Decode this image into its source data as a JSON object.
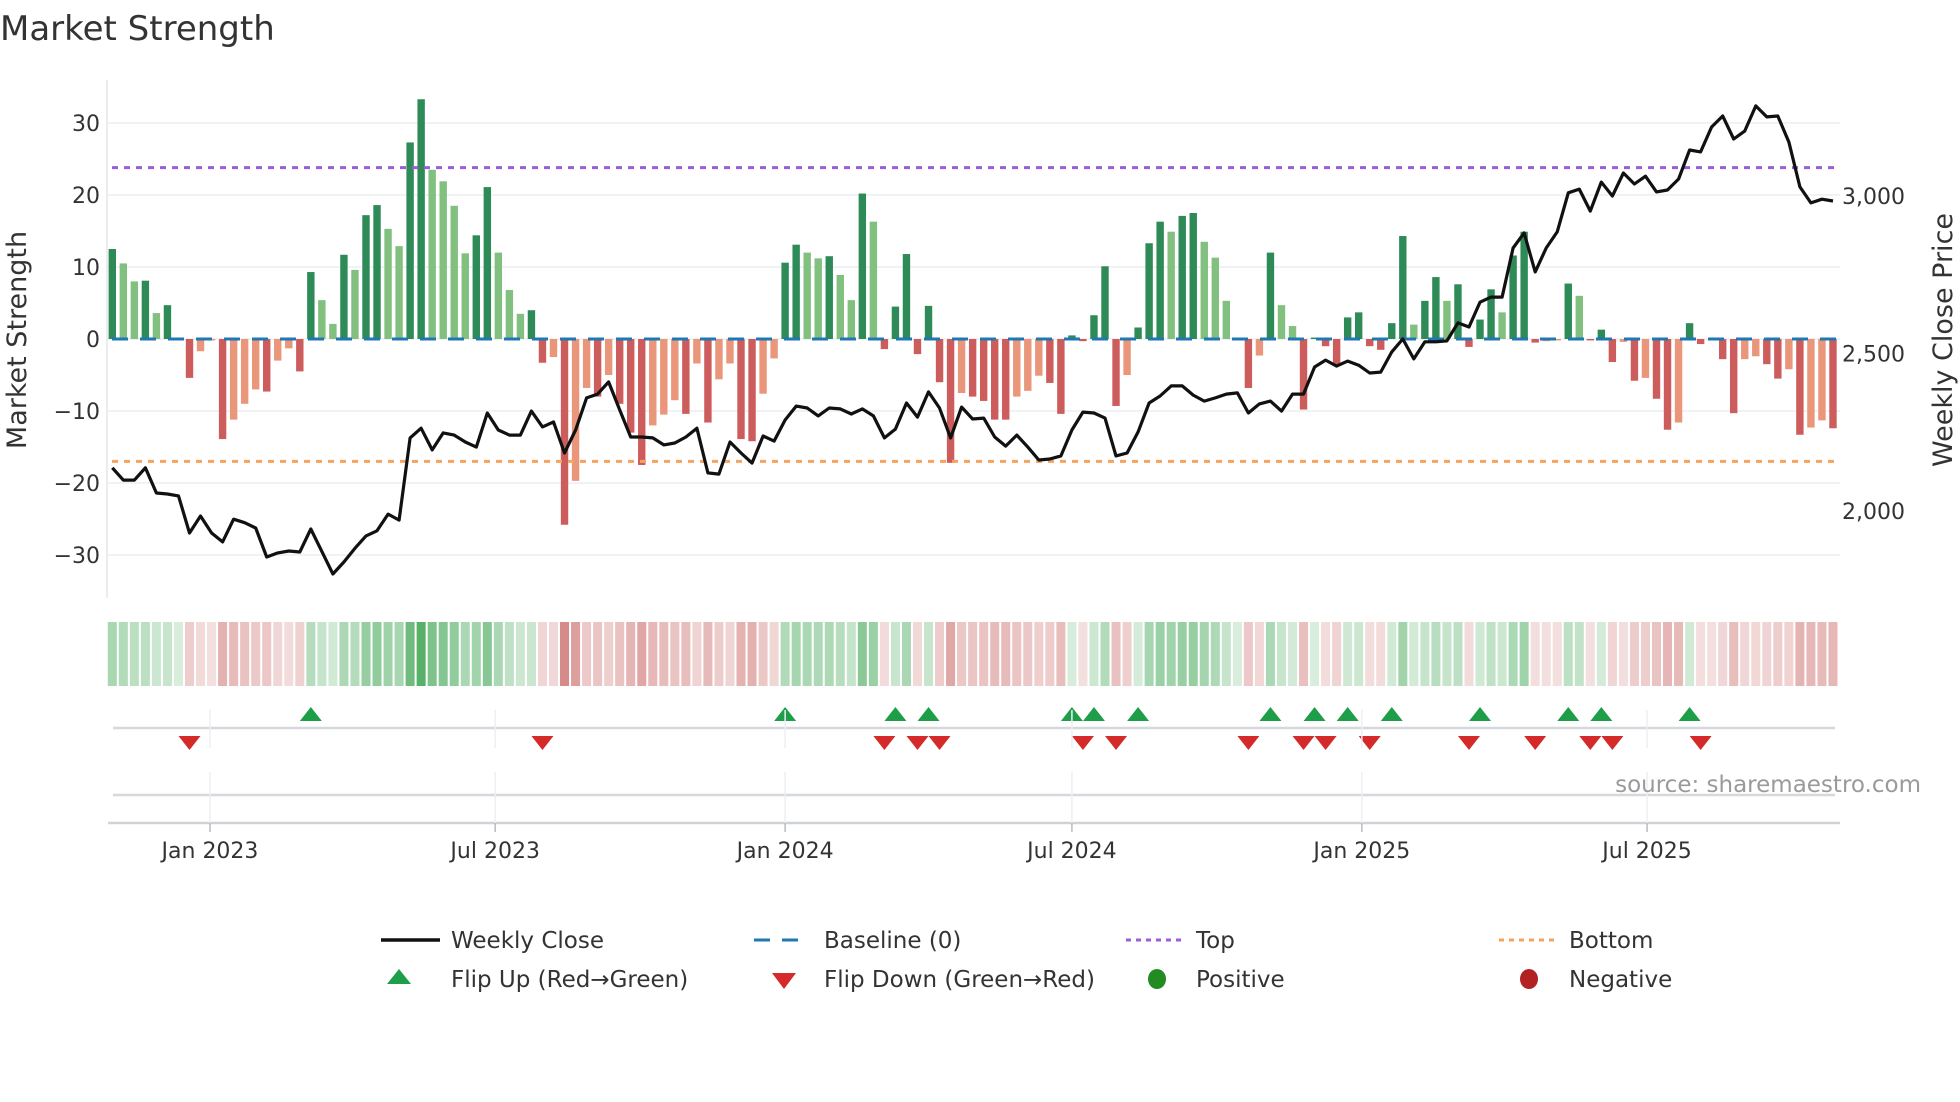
{
  "chart_data": {
    "type": "bar",
    "title": "Market Strength",
    "ylabel": "Market Strength",
    "y2label": "Weekly Close Price",
    "ylim": [
      -36,
      36
    ],
    "y2lim": [
      1700,
      3400
    ],
    "yticks": [
      30,
      20,
      10,
      0,
      -10,
      -20,
      -30
    ],
    "ytick_labels": [
      "30",
      "20",
      "10",
      "0",
      "−10",
      "−20",
      "−30"
    ],
    "y2ticks": [
      3000,
      2500,
      2000
    ],
    "y2tick_labels": [
      "3,000",
      "2,500",
      "2,000"
    ],
    "x_start": "2022-10-31",
    "x_step_days": 7,
    "xticks": [
      "2023-01-01",
      "2023-07-01",
      "2024-01-01",
      "2024-07-01",
      "2025-01-01",
      "2025-07-01"
    ],
    "xtick_labels": [
      "Jan 2023",
      "Jul 2023",
      "Jan 2024",
      "Jul 2024",
      "Jan 2025",
      "Jul 2025"
    ],
    "top_level": 23.8,
    "bottom_level": -17.0,
    "baseline": 0,
    "series": [
      {
        "name": "Market Strength",
        "type": "bar",
        "values": [
          12.5,
          10.5,
          8,
          8.1,
          3.6,
          4.7,
          0.2,
          -5.4,
          -1.7,
          -0.2,
          -13.9,
          -11.2,
          -9,
          -7,
          -7.3,
          -3,
          -1.3,
          -4.5,
          9.3,
          5.4,
          2.1,
          11.7,
          9.6,
          17.2,
          18.6,
          15.3,
          12.9,
          27.3,
          33.3,
          23.5,
          21.9,
          18.5,
          11.9,
          14.4,
          21.1,
          12,
          6.8,
          3.5,
          4,
          -3.3,
          -2.5,
          -25.8,
          -19.7,
          -6.8,
          -8,
          -5,
          -9,
          -13,
          -17.5,
          -12,
          -10.5,
          -8.5,
          -10.4,
          -3.4,
          -11.6,
          -5.6,
          -3.4,
          -13.9,
          -14.2,
          -7.6,
          -2.7,
          10.6,
          13.1,
          12,
          11.2,
          11.5,
          8.9,
          5.4,
          20.2,
          16.3,
          -1.4,
          4.5,
          11.8,
          -2.1,
          4.6,
          -6,
          -17.2,
          -7.5,
          -8,
          -8.6,
          -11.2,
          -11.2,
          -8,
          -7.2,
          -5.1,
          -6.1,
          -10.4,
          0.5,
          -0.3,
          3.3,
          10.1,
          -9.3,
          -5,
          1.6,
          13.3,
          16.3,
          14.9,
          17.1,
          17.5,
          13.5,
          11.3,
          5.3,
          0.2,
          -6.8,
          -2.3,
          12,
          4.7,
          1.8,
          -9.8,
          0.2,
          -1,
          -3.6,
          3,
          3.7,
          -1,
          -1.5,
          2.2,
          14.3,
          2,
          5.3,
          8.6,
          5.3,
          7.6,
          -1.1,
          2.7,
          6.9,
          3.7,
          11.6,
          14.9,
          -0.5,
          -0.3,
          -0.2,
          7.7,
          6,
          -0.2,
          1.3,
          -3.2,
          -0.4,
          -5.8,
          -5.4,
          -8.3,
          -12.6,
          -11.6,
          2.2,
          -0.7,
          -0.2,
          -2.8,
          -10.3,
          -2.8,
          -2.4,
          -3.5,
          -5.5,
          -4.2,
          -13.3,
          -12.3,
          -11.3,
          -12.4
        ]
      },
      {
        "name": "Weekly Close",
        "type": "line",
        "axis": "right",
        "values": [
          2137,
          2098,
          2098,
          2137,
          2057,
          2054,
          2048,
          1930,
          1984,
          1930,
          1902,
          1974,
          1963,
          1946,
          1854,
          1867,
          1873,
          1870,
          1943,
          1871,
          1800,
          1838,
          1882,
          1921,
          1937,
          1990,
          1971,
          2232,
          2263,
          2194,
          2248,
          2241,
          2219,
          2203,
          2311,
          2257,
          2241,
          2241,
          2317,
          2267,
          2283,
          2184,
          2257,
          2359,
          2371,
          2410,
          2321,
          2235,
          2235,
          2232,
          2210,
          2216,
          2235,
          2263,
          2121,
          2117,
          2219,
          2184,
          2152,
          2238,
          2222,
          2289,
          2333,
          2327,
          2302,
          2327,
          2324,
          2308,
          2324,
          2302,
          2232,
          2260,
          2343,
          2298,
          2378,
          2327,
          2232,
          2330,
          2292,
          2295,
          2235,
          2206,
          2241,
          2203,
          2162,
          2165,
          2175,
          2257,
          2314,
          2311,
          2295,
          2175,
          2184,
          2251,
          2343,
          2365,
          2397,
          2397,
          2368,
          2349,
          2359,
          2371,
          2375,
          2311,
          2340,
          2349,
          2317,
          2371,
          2371,
          2457,
          2479,
          2460,
          2476,
          2463,
          2438,
          2441,
          2505,
          2546,
          2483,
          2537,
          2537,
          2540,
          2597,
          2584,
          2663,
          2679,
          2679,
          2835,
          2883,
          2759,
          2835,
          2886,
          3010,
          3022,
          2952,
          3044,
          3000,
          3073,
          3038,
          3063,
          3013,
          3019,
          3054,
          3146,
          3140,
          3219,
          3254,
          3181,
          3206,
          3286,
          3251,
          3254,
          3171,
          3029,
          2978,
          2990,
          2984
        ]
      }
    ],
    "legend": {
      "placement": "bottom",
      "items": [
        {
          "label": "Weekly Close",
          "symbol": "line"
        },
        {
          "label": "Baseline (0)",
          "symbol": "dash"
        },
        {
          "label": "Top",
          "symbol": "dot"
        },
        {
          "label": "Bottom",
          "symbol": "dot"
        },
        {
          "label": "Flip Up (Red→Green)",
          "symbol": "triangle-up"
        },
        {
          "label": "Flip Down (Green→Red)",
          "symbol": "triangle-down"
        },
        {
          "label": "Positive",
          "symbol": "circle"
        },
        {
          "label": "Negative",
          "symbol": "circle"
        }
      ]
    },
    "source": "source: sharemaestro.com",
    "grid": true
  },
  "colors": {
    "pos_strong": "#2e8b57",
    "pos_weak": "#81c07f",
    "neg_strong": "#cd5c5c",
    "neg_weak": "#e9967a",
    "line": "#111111",
    "baseline": "#1f77b4",
    "top": "#9a5fd6",
    "bottom": "#f4a460",
    "flip_up": "#1e9e48",
    "flip_down": "#d42a2a",
    "positive": "#228b22",
    "negative": "#b22222",
    "grid": "#eceff3"
  }
}
